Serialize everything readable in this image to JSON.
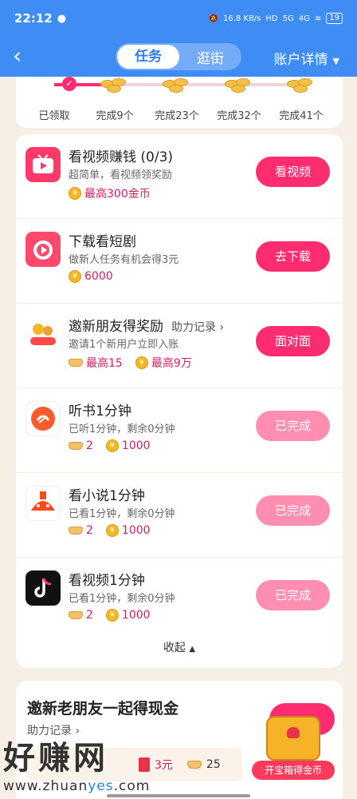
{
  "statusbar": {
    "time": "22:12",
    "net_speed": "16.8 KB/s",
    "signal_5g": "5G",
    "signal_4g": "4G",
    "battery": "19"
  },
  "nav": {
    "tabs": [
      "任务",
      "逛街"
    ],
    "active_tab": "任务",
    "account_label": "账户详情"
  },
  "progress": {
    "milestones": [
      "已领取",
      "完成9个",
      "完成23个",
      "完成32个",
      "完成41个"
    ],
    "fill_fraction": 0.22
  },
  "tasks": [
    {
      "icon": "video-tv-icon",
      "title": "看视频赚钱 (0/3)",
      "desc": "超简单，看视频领奖励",
      "reward_coin": "最高300金币",
      "button": "看视频",
      "done": false
    },
    {
      "icon": "short-drama-icon",
      "title": "下载看短剧",
      "desc": "做新人任务有机会得3元",
      "reward_coin": "6000",
      "button": "去下载",
      "done": false
    },
    {
      "icon": "invite-friend-icon",
      "title": "邀新朋友得奖励",
      "helper": "助力记录",
      "desc": "邀请1个新用户立即入账",
      "reward_ingot": "最高15",
      "reward_coin": "最高9万",
      "button": "面对面",
      "done": false
    },
    {
      "icon": "audiobook-icon",
      "title": "听书1分钟",
      "desc": "已听1分钟，剩余0分钟",
      "reward_ingot": "2",
      "reward_coin": "1000",
      "button": "已完成",
      "done": true
    },
    {
      "icon": "novel-icon",
      "title": "看小说1分钟",
      "desc": "已看1分钟，剩余0分钟",
      "reward_ingot": "2",
      "reward_coin": "1000",
      "button": "已完成",
      "done": true
    },
    {
      "icon": "tiktok-icon",
      "title": "看视频1分钟",
      "desc": "已看1分钟，剩余0分钟",
      "reward_ingot": "2",
      "reward_coin": "1000",
      "button": "已完成",
      "done": true
    }
  ],
  "collapse_label": "收起",
  "invite": {
    "title": "邀新老朋友一起得现金",
    "helper": "助力记录",
    "cash": "3元",
    "ingot": "25"
  },
  "chest_label": "开宝箱得金币",
  "watermark": {
    "big": "好赚网",
    "url_prefix": "www.zhuan",
    "url_highlight": "yes",
    "url_suffix": ".com"
  },
  "colors": {
    "nav_blue": "#3f8cf4",
    "accent_pink": "#ff2d6f",
    "done_pink": "#ff8eb1",
    "background": "#f6efe6"
  }
}
